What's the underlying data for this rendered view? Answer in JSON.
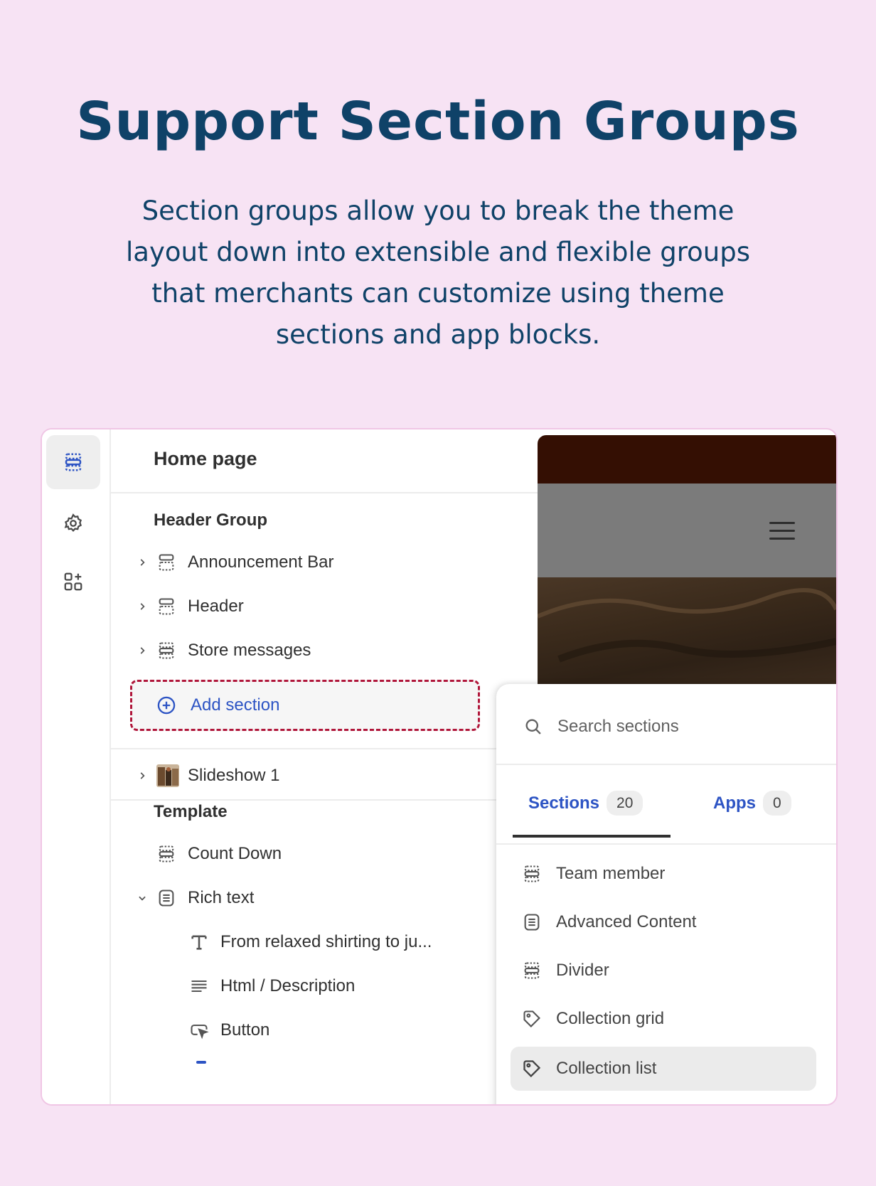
{
  "hero": {
    "title": "Support Section Groups",
    "subtitle": "Section groups allow you to break the theme layout down into extensible and flexible groups that merchants can customize using theme sections and app blocks."
  },
  "editor": {
    "page_title": "Home page",
    "header_group": {
      "label": "Header Group",
      "items": [
        {
          "label": "Announcement Bar",
          "icon": "section-dashed-top-icon"
        },
        {
          "label": "Header",
          "icon": "section-dashed-top-icon"
        },
        {
          "label": "Store messages",
          "icon": "section-dashed-icon"
        }
      ],
      "add_label": "Add section"
    },
    "slideshow": {
      "label": "Slideshow 1",
      "icon": "image-thumbnail"
    },
    "template": {
      "label": "Template",
      "items": [
        {
          "label": "Count Down",
          "icon": "section-dashed-icon"
        },
        {
          "label": "Rich text",
          "icon": "text-block-icon",
          "expanded": true
        }
      ],
      "blocks": [
        {
          "label": "From relaxed shirting to ju...",
          "icon": "text-t-icon"
        },
        {
          "label": "Html / Description",
          "icon": "paragraph-icon"
        },
        {
          "label": "Button",
          "icon": "cursor-button-icon",
          "hidden": true
        }
      ]
    }
  },
  "picker": {
    "search_placeholder": "Search sections",
    "tabs": [
      {
        "label": "Sections",
        "count": "20",
        "active": true
      },
      {
        "label": "Apps",
        "count": "0",
        "active": false
      }
    ],
    "items": [
      {
        "label": "Team member",
        "icon": "section-dashed-icon"
      },
      {
        "label": "Advanced Content",
        "icon": "text-block-icon"
      },
      {
        "label": "Divider",
        "icon": "section-dashed-icon"
      },
      {
        "label": "Collection grid",
        "icon": "tag-icon"
      },
      {
        "label": "Collection list",
        "icon": "tag-icon",
        "highlighted": true
      }
    ]
  },
  "colors": {
    "background": "#f7e3f4",
    "heading": "#0f4268",
    "accent_blue": "#2d54c4",
    "dashed_border": "#b0163a"
  }
}
